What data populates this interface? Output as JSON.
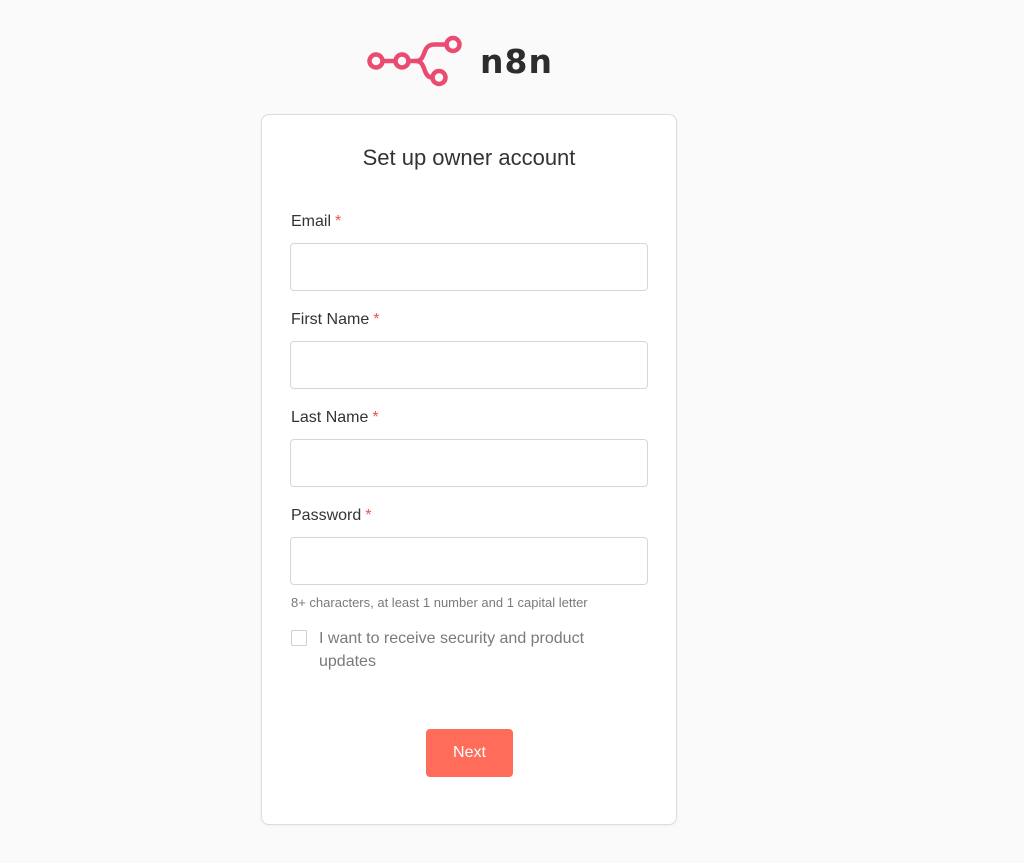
{
  "logo": {
    "text": "n8n",
    "color": "#ea4b71"
  },
  "form": {
    "title": "Set up owner account",
    "required_marker": "*",
    "fields": {
      "email": {
        "label": "Email",
        "value": "",
        "placeholder": ""
      },
      "first_name": {
        "label": "First Name",
        "value": "",
        "placeholder": ""
      },
      "last_name": {
        "label": "Last Name",
        "value": "",
        "placeholder": ""
      },
      "password": {
        "label": "Password",
        "value": "",
        "placeholder": ""
      }
    },
    "password_hint": "8+ characters, at least 1 number and 1 capital letter",
    "updates_checkbox": {
      "label": "I want to receive security and product updates",
      "checked": false
    },
    "next_label": "Next",
    "accent_color": "#ff6d5a"
  }
}
